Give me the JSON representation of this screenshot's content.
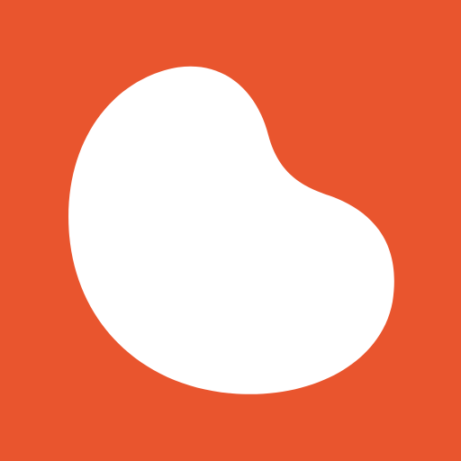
{
  "icon": {
    "name": "bean-logo-icon",
    "background_color": "#E9552E",
    "shape_color": "#FFFFFF"
  }
}
